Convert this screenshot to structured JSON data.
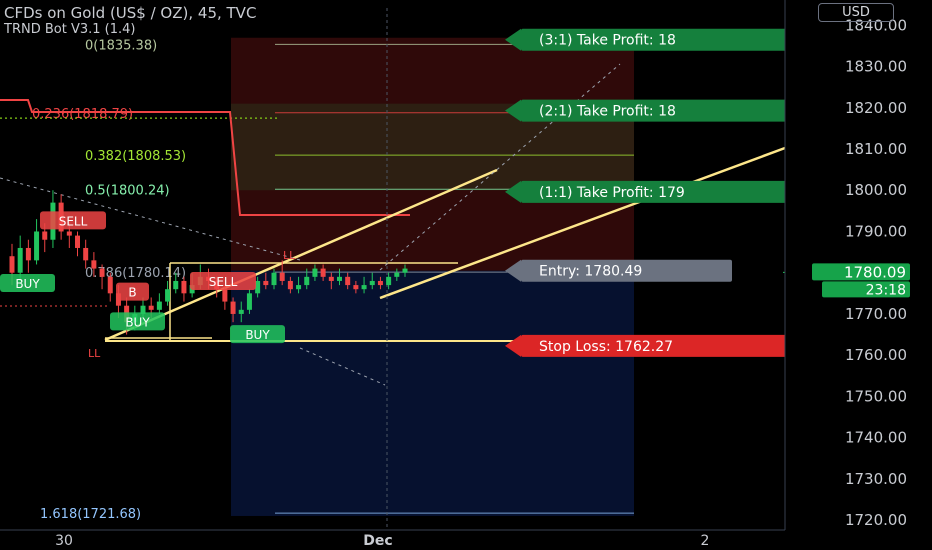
{
  "header": {
    "symbol_line": "CFDs on Gold (US$ / OZ), 45, TVC",
    "indicator_line": "TRND Bot V3.1 (1.4)"
  },
  "currency_button": "USD",
  "chart_data": {
    "type": "candlestick",
    "price_axis_ticks": [
      1840.0,
      1830.0,
      1820.0,
      1810.0,
      1800.0,
      1790.0,
      1780.0,
      1770.0,
      1760.0,
      1750.0,
      1740.0,
      1730.0,
      1720.0
    ],
    "ylim": [
      1717.6,
      1844.2
    ],
    "time_axis_labels": [
      "30",
      "Dec",
      "2"
    ],
    "current_price": "1780.09",
    "countdown": "23:18",
    "fib_levels": [
      {
        "label": "0(1835.38)",
        "price": 1835.38
      },
      {
        "label": "0.236(1818.79)",
        "price": 1818.79
      },
      {
        "label": "0.382(1808.53)",
        "price": 1808.53
      },
      {
        "label": "0.5(1800.24)",
        "price": 1800.24
      },
      {
        "label": "0.786(1780.14)",
        "price": 1780.14
      },
      {
        "label": "1.618(1721.68)",
        "price": 1721.68
      }
    ],
    "position_labels": [
      {
        "text": "(3:1) Take Profit: 18",
        "kind": "tp",
        "price": 1836.5
      },
      {
        "text": "(2:1) Take Profit: 18",
        "kind": "tp",
        "price": 1819.3
      },
      {
        "text": "(1:1) Take Profit: 179",
        "kind": "tp",
        "price": 1799.6
      },
      {
        "text": "Entry: 1780.49",
        "kind": "entry",
        "price": 1780.49
      },
      {
        "text": "Stop Loss: 1762.27",
        "kind": "sl",
        "price": 1762.27
      }
    ],
    "signals": [
      {
        "text": "BUY",
        "color": "#22c55e",
        "price": 1777.5
      },
      {
        "text": "SELL",
        "color": "#ef4444",
        "price": 1792.7
      },
      {
        "text": "SELL",
        "color": "#ef4444",
        "price": 1778.0
      },
      {
        "text": "B",
        "color": "#ef4444",
        "price": 1775.4
      },
      {
        "text": "BUY",
        "color": "#22c55e",
        "price": 1768.2
      },
      {
        "text": "BUY",
        "color": "#22c55e",
        "price": 1765.1
      }
    ],
    "swing_labels": [
      "LL",
      "LL"
    ],
    "candles": [
      [
        1784,
        1780,
        1787,
        1777
      ],
      [
        1780,
        1786,
        1789,
        1778
      ],
      [
        1786,
        1783,
        1788,
        1780
      ],
      [
        1783,
        1790,
        1793,
        1782
      ],
      [
        1790,
        1788,
        1792,
        1785
      ],
      [
        1788,
        1797,
        1800,
        1786
      ],
      [
        1797,
        1790,
        1799,
        1788
      ],
      [
        1790,
        1789,
        1792,
        1786
      ],
      [
        1789,
        1786,
        1790,
        1784
      ],
      [
        1786,
        1783,
        1788,
        1781
      ],
      [
        1783,
        1781,
        1785,
        1779
      ],
      [
        1781,
        1779,
        1782,
        1776
      ],
      [
        1779,
        1775,
        1780,
        1773
      ],
      [
        1775,
        1772,
        1777,
        1769
      ],
      [
        1772,
        1768,
        1774,
        1765
      ],
      [
        1768,
        1770,
        1772,
        1766
      ],
      [
        1770,
        1772,
        1774,
        1768
      ],
      [
        1772,
        1771,
        1774,
        1769
      ],
      [
        1771,
        1773,
        1775,
        1770
      ],
      [
        1773,
        1776,
        1778,
        1772
      ],
      [
        1776,
        1778,
        1780,
        1775
      ],
      [
        1778,
        1775,
        1779,
        1773
      ],
      [
        1775,
        1777,
        1780,
        1774
      ],
      [
        1777,
        1779,
        1782,
        1776
      ],
      [
        1779,
        1778,
        1781,
        1776
      ],
      [
        1778,
        1776,
        1779,
        1774
      ],
      [
        1776,
        1773,
        1777,
        1771
      ],
      [
        1773,
        1770,
        1774,
        1768
      ],
      [
        1770,
        1771,
        1773,
        1768
      ],
      [
        1771,
        1775,
        1776,
        1770
      ],
      [
        1775,
        1778,
        1779,
        1774
      ],
      [
        1778,
        1777,
        1780,
        1776
      ],
      [
        1777,
        1780,
        1781,
        1776
      ],
      [
        1780,
        1778,
        1783,
        1777
      ],
      [
        1778,
        1776,
        1779,
        1775
      ],
      [
        1776,
        1777,
        1779,
        1775
      ],
      [
        1777,
        1779,
        1781,
        1776
      ],
      [
        1779,
        1781,
        1782,
        1778
      ],
      [
        1781,
        1779,
        1782,
        1778
      ],
      [
        1779,
        1778,
        1780,
        1776
      ],
      [
        1778,
        1779,
        1781,
        1777
      ],
      [
        1779,
        1777,
        1780,
        1776
      ],
      [
        1777,
        1776,
        1778,
        1775
      ],
      [
        1776,
        1777,
        1779,
        1775
      ],
      [
        1777,
        1778,
        1780,
        1776
      ],
      [
        1778,
        1777,
        1779,
        1776
      ],
      [
        1777,
        1779,
        1780,
        1776
      ],
      [
        1779,
        1780,
        1781,
        1778
      ],
      [
        1780,
        1781,
        1782,
        1779
      ]
    ]
  }
}
